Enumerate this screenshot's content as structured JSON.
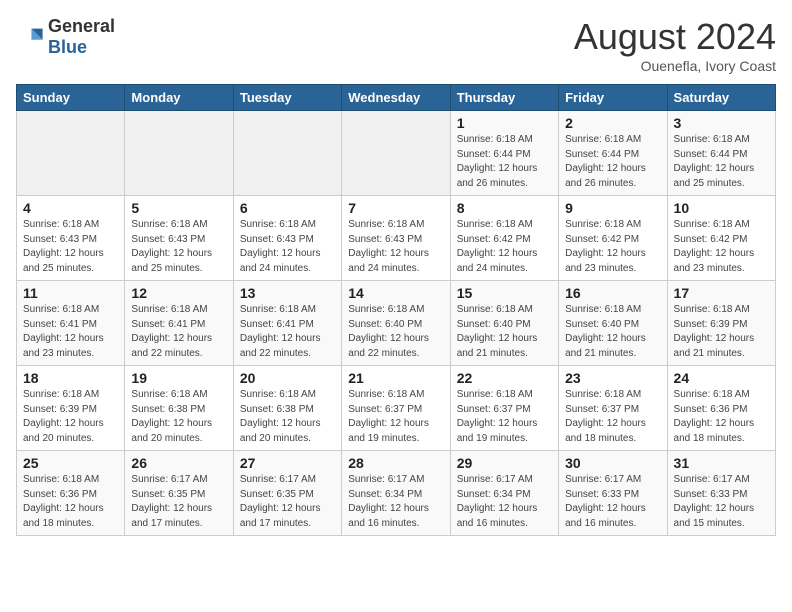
{
  "header": {
    "logo_general": "General",
    "logo_blue": "Blue",
    "title": "August 2024",
    "subtitle": "Ouenefla, Ivory Coast"
  },
  "days_of_week": [
    "Sunday",
    "Monday",
    "Tuesday",
    "Wednesday",
    "Thursday",
    "Friday",
    "Saturday"
  ],
  "weeks": [
    [
      {
        "day": "",
        "info": ""
      },
      {
        "day": "",
        "info": ""
      },
      {
        "day": "",
        "info": ""
      },
      {
        "day": "",
        "info": ""
      },
      {
        "day": "1",
        "info": "Sunrise: 6:18 AM\nSunset: 6:44 PM\nDaylight: 12 hours and 26 minutes."
      },
      {
        "day": "2",
        "info": "Sunrise: 6:18 AM\nSunset: 6:44 PM\nDaylight: 12 hours and 26 minutes."
      },
      {
        "day": "3",
        "info": "Sunrise: 6:18 AM\nSunset: 6:44 PM\nDaylight: 12 hours and 25 minutes."
      }
    ],
    [
      {
        "day": "4",
        "info": "Sunrise: 6:18 AM\nSunset: 6:43 PM\nDaylight: 12 hours and 25 minutes."
      },
      {
        "day": "5",
        "info": "Sunrise: 6:18 AM\nSunset: 6:43 PM\nDaylight: 12 hours and 25 minutes."
      },
      {
        "day": "6",
        "info": "Sunrise: 6:18 AM\nSunset: 6:43 PM\nDaylight: 12 hours and 24 minutes."
      },
      {
        "day": "7",
        "info": "Sunrise: 6:18 AM\nSunset: 6:43 PM\nDaylight: 12 hours and 24 minutes."
      },
      {
        "day": "8",
        "info": "Sunrise: 6:18 AM\nSunset: 6:42 PM\nDaylight: 12 hours and 24 minutes."
      },
      {
        "day": "9",
        "info": "Sunrise: 6:18 AM\nSunset: 6:42 PM\nDaylight: 12 hours and 23 minutes."
      },
      {
        "day": "10",
        "info": "Sunrise: 6:18 AM\nSunset: 6:42 PM\nDaylight: 12 hours and 23 minutes."
      }
    ],
    [
      {
        "day": "11",
        "info": "Sunrise: 6:18 AM\nSunset: 6:41 PM\nDaylight: 12 hours and 23 minutes."
      },
      {
        "day": "12",
        "info": "Sunrise: 6:18 AM\nSunset: 6:41 PM\nDaylight: 12 hours and 22 minutes."
      },
      {
        "day": "13",
        "info": "Sunrise: 6:18 AM\nSunset: 6:41 PM\nDaylight: 12 hours and 22 minutes."
      },
      {
        "day": "14",
        "info": "Sunrise: 6:18 AM\nSunset: 6:40 PM\nDaylight: 12 hours and 22 minutes."
      },
      {
        "day": "15",
        "info": "Sunrise: 6:18 AM\nSunset: 6:40 PM\nDaylight: 12 hours and 21 minutes."
      },
      {
        "day": "16",
        "info": "Sunrise: 6:18 AM\nSunset: 6:40 PM\nDaylight: 12 hours and 21 minutes."
      },
      {
        "day": "17",
        "info": "Sunrise: 6:18 AM\nSunset: 6:39 PM\nDaylight: 12 hours and 21 minutes."
      }
    ],
    [
      {
        "day": "18",
        "info": "Sunrise: 6:18 AM\nSunset: 6:39 PM\nDaylight: 12 hours and 20 minutes."
      },
      {
        "day": "19",
        "info": "Sunrise: 6:18 AM\nSunset: 6:38 PM\nDaylight: 12 hours and 20 minutes."
      },
      {
        "day": "20",
        "info": "Sunrise: 6:18 AM\nSunset: 6:38 PM\nDaylight: 12 hours and 20 minutes."
      },
      {
        "day": "21",
        "info": "Sunrise: 6:18 AM\nSunset: 6:37 PM\nDaylight: 12 hours and 19 minutes."
      },
      {
        "day": "22",
        "info": "Sunrise: 6:18 AM\nSunset: 6:37 PM\nDaylight: 12 hours and 19 minutes."
      },
      {
        "day": "23",
        "info": "Sunrise: 6:18 AM\nSunset: 6:37 PM\nDaylight: 12 hours and 18 minutes."
      },
      {
        "day": "24",
        "info": "Sunrise: 6:18 AM\nSunset: 6:36 PM\nDaylight: 12 hours and 18 minutes."
      }
    ],
    [
      {
        "day": "25",
        "info": "Sunrise: 6:18 AM\nSunset: 6:36 PM\nDaylight: 12 hours and 18 minutes."
      },
      {
        "day": "26",
        "info": "Sunrise: 6:17 AM\nSunset: 6:35 PM\nDaylight: 12 hours and 17 minutes."
      },
      {
        "day": "27",
        "info": "Sunrise: 6:17 AM\nSunset: 6:35 PM\nDaylight: 12 hours and 17 minutes."
      },
      {
        "day": "28",
        "info": "Sunrise: 6:17 AM\nSunset: 6:34 PM\nDaylight: 12 hours and 16 minutes."
      },
      {
        "day": "29",
        "info": "Sunrise: 6:17 AM\nSunset: 6:34 PM\nDaylight: 12 hours and 16 minutes."
      },
      {
        "day": "30",
        "info": "Sunrise: 6:17 AM\nSunset: 6:33 PM\nDaylight: 12 hours and 16 minutes."
      },
      {
        "day": "31",
        "info": "Sunrise: 6:17 AM\nSunset: 6:33 PM\nDaylight: 12 hours and 15 minutes."
      }
    ]
  ]
}
